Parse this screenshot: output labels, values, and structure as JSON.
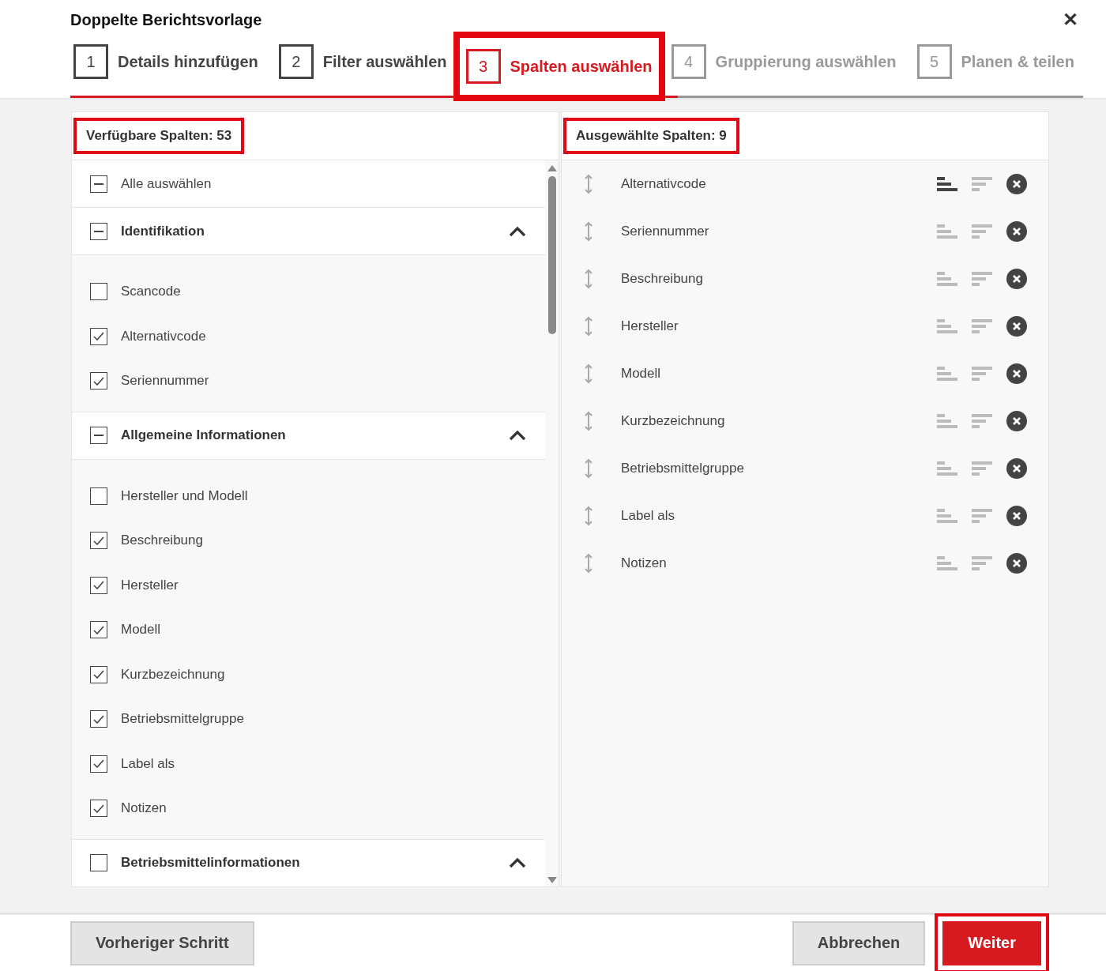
{
  "dialog": {
    "title": "Doppelte Berichtsvorlage",
    "close": "✕"
  },
  "steps": [
    {
      "number": "1",
      "label": "Details hinzufügen",
      "selected": false
    },
    {
      "number": "2",
      "label": "Filter auswählen",
      "selected": false
    },
    {
      "number": "3",
      "label": "Spalten auswählen",
      "selected": true
    },
    {
      "number": "4",
      "label": "Gruppierung auswählen",
      "selected": false
    },
    {
      "number": "5",
      "label": "Planen & teilen",
      "selected": false
    }
  ],
  "available": {
    "heading": "Verfügbare Spalten: 53",
    "highlighted": true,
    "select_all": {
      "label": "Alle auswählen",
      "partial": true
    },
    "groups": [
      {
        "label": "Identifikation",
        "partial": true,
        "expanded": true,
        "items": [
          {
            "label": "Scancode",
            "checked": false
          },
          {
            "label": "Alternativcode",
            "checked": true
          },
          {
            "label": "Seriennummer",
            "checked": true
          }
        ]
      },
      {
        "label": "Allgemeine Informationen",
        "partial": true,
        "expanded": true,
        "items": [
          {
            "label": "Hersteller und Modell",
            "checked": false
          },
          {
            "label": "Beschreibung",
            "checked": true
          },
          {
            "label": "Hersteller",
            "checked": true
          },
          {
            "label": "Modell",
            "checked": true
          },
          {
            "label": "Kurzbezeichnung",
            "checked": true
          },
          {
            "label": "Betriebsmittelgruppe",
            "checked": true
          },
          {
            "label": "Label als",
            "checked": true
          },
          {
            "label": "Notizen",
            "checked": true
          }
        ]
      },
      {
        "label": "Betriebsmittelinformationen",
        "partial": false,
        "expanded": true
      }
    ]
  },
  "selected": {
    "heading": "Ausgewählte Spalten: 9",
    "highlighted": true,
    "rows": [
      {
        "label": "Alternativcode",
        "sort_ascending": true
      },
      {
        "label": "Seriennummer",
        "sort_ascending": false
      },
      {
        "label": "Beschreibung",
        "sort_ascending": false
      },
      {
        "label": "Hersteller",
        "sort_ascending": false
      },
      {
        "label": "Modell",
        "sort_ascending": false
      },
      {
        "label": "Kurzbezeichnung",
        "sort_ascending": false
      },
      {
        "label": "Betriebsmittelgruppe",
        "sort_ascending": false
      },
      {
        "label": "Label als",
        "sort_ascending": false
      },
      {
        "label": "Notizen",
        "sort_ascending": false
      }
    ]
  },
  "footer": {
    "back": {
      "label": "Vorheriger Schritt",
      "highlighted": false
    },
    "cancel": {
      "label": "Abbrechen",
      "highlighted": false
    },
    "next": {
      "label": "Weiter",
      "highlighted": true
    }
  }
}
